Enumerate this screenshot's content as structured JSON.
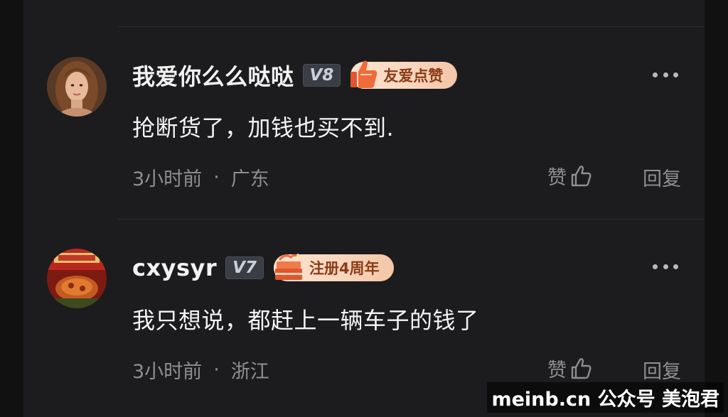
{
  "comments": [
    {
      "username": "我爱你么么哒哒",
      "level": "V8",
      "honor_badge": "友爱点赞",
      "text": "抢断货了，加钱也买不到.",
      "time": "3小时前",
      "separator": "·",
      "location": "广东",
      "like_label": "赞",
      "reply_label": "回复",
      "avatar": "woman-portrait-avatar",
      "badge_icon": "thumbs-up-icon"
    },
    {
      "username": "cxysyr",
      "level": "V7",
      "honor_badge": "注册4周年",
      "text": "我只想说，都赶上一辆车子的钱了",
      "time": "3小时前",
      "separator": "·",
      "location": "浙江",
      "like_label": "赞",
      "reply_label": "回复",
      "avatar": "instant-noodle-avatar",
      "badge_icon": "anniversary-cake-icon"
    }
  ],
  "watermark": "meinb.cn  公众号 美泡君",
  "colors": {
    "background": "#1c1c1e",
    "text_primary": "#f2f2f2",
    "text_secondary": "#8e8e93",
    "badge_bg": "#fde3cf",
    "badge_text": "#8a3c17"
  }
}
